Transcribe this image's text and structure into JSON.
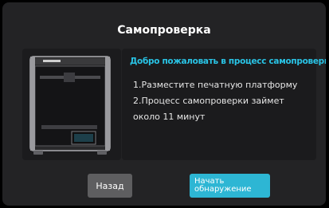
{
  "title": "Самопроверка",
  "image": {
    "icon": "3d-printer-image"
  },
  "info": {
    "heading": "Добро пожаловать в процесс самопроверки",
    "steps": [
      "1.Разместите печатную платформу",
      "2.Процесс самопроверки займет",
      "около 11 минут"
    ]
  },
  "buttons": {
    "back_label": "Назад",
    "start_label_line1": "Начать",
    "start_label_line2": "обнаружение"
  },
  "colors": {
    "background": "#232325",
    "panel": "#1b1b1d",
    "accent": "#2db6d4",
    "heading": "#29c4e6",
    "secondary_button": "#5e5e60"
  }
}
